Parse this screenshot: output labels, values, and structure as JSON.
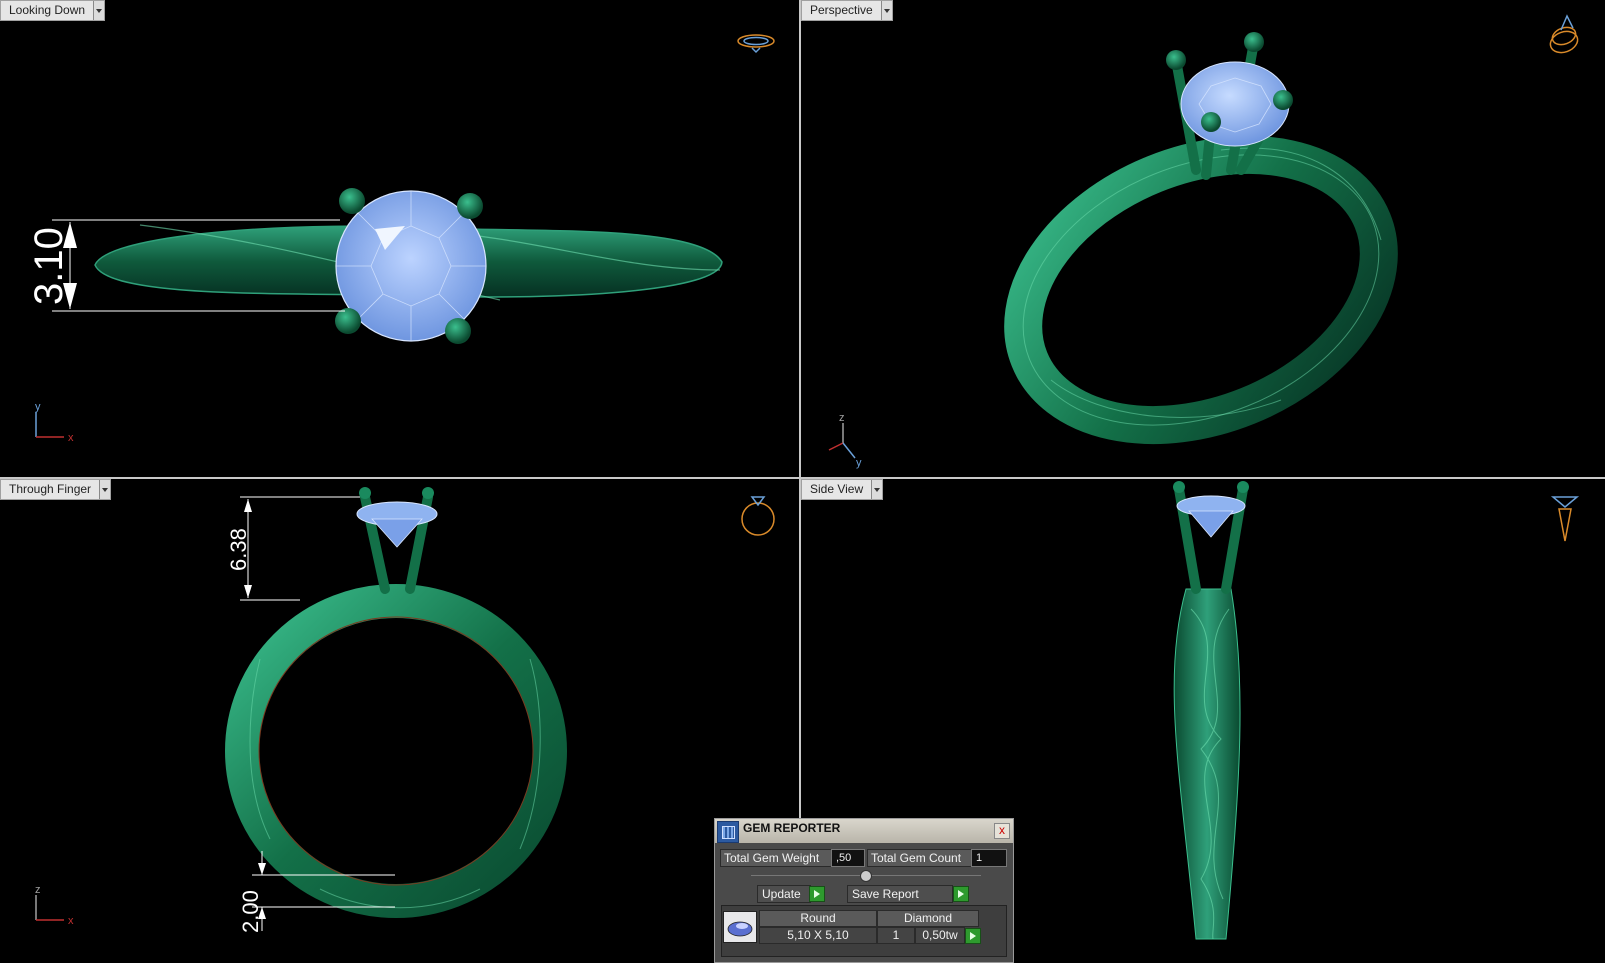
{
  "viewports": {
    "top_left": {
      "label": "Looking Down",
      "dimension": "3.10",
      "axis": {
        "vertical": "y",
        "horizontal": "x"
      }
    },
    "top_right": {
      "label": "Perspective",
      "axis": {
        "z": "z",
        "y": "y"
      }
    },
    "bottom_left": {
      "label": "Through Finger",
      "dimension_top": "6.38",
      "dimension_bottom": "2.00",
      "axis": {
        "vertical": "z",
        "horizontal": "x"
      }
    },
    "bottom_right": {
      "label": "Side View"
    }
  },
  "gem_reporter": {
    "title": "GEM REPORTER",
    "close": "x",
    "total_weight_label": "Total Gem Weight",
    "total_weight_value": ",50",
    "total_count_label": "Total Gem Count",
    "total_count_value": "1",
    "update_label": "Update",
    "save_report_label": "Save Report",
    "gem": {
      "shape": "Round",
      "material": "Diamond",
      "size": "5,10 X 5,10",
      "count": "1",
      "weight": "0,50tw"
    }
  },
  "colors": {
    "metal": "#1f7a55",
    "gem": "#8fb3f0",
    "viewcube": "#d98a2a",
    "axis_x": "#c03030",
    "axis_y": "#6aa0d8",
    "axis_z": "#a0a0a0"
  }
}
